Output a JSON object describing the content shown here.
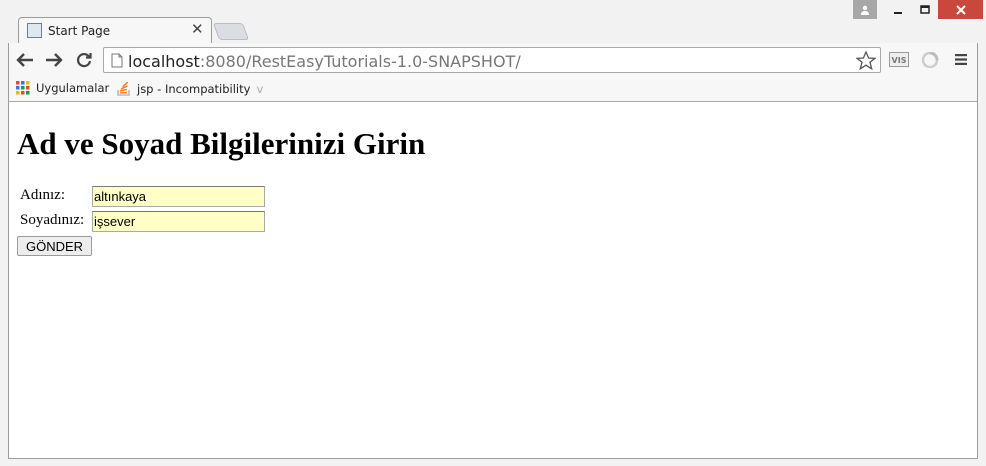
{
  "browser": {
    "tab_title": "Start Page",
    "url_host": "localhost",
    "url_rest": ":8080/RestEasyTutorials-1.0-SNAPSHOT/",
    "bookmarks": [
      {
        "label": "Uygulamalar",
        "icon": "apps-grid-icon"
      },
      {
        "label": "jsp - Incompatibility",
        "suffix": "v",
        "icon": "stackoverflow-icon"
      }
    ],
    "ext1_label": "VIS"
  },
  "page": {
    "heading": "Ad ve Soyad Bilgilerinizi Girin",
    "first_name_label": "Adınız:",
    "first_name_value": "altınkaya",
    "last_name_label": "Soyadınız:",
    "last_name_value": "işsever",
    "submit_label": "GÖNDER"
  },
  "colors": {
    "input_autofill": "#ffffc8",
    "close_button": "#c9483c"
  }
}
